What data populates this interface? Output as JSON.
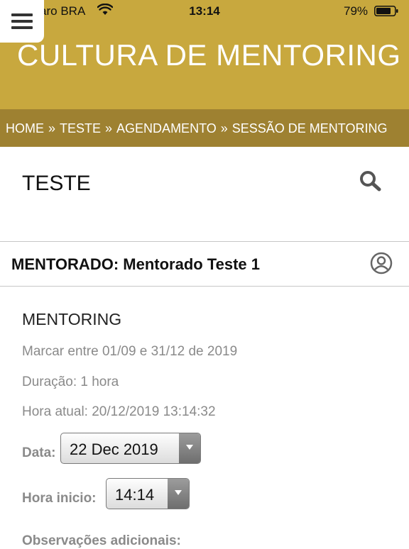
{
  "status_bar": {
    "carrier": "Claro BRA",
    "time": "13:14",
    "battery": "79%"
  },
  "header": {
    "title": "CULTURA DE MENTORING"
  },
  "breadcrumb": {
    "items": [
      "HOME",
      "TESTE",
      "AGENDAMENTO",
      "SESSÃO DE MENTORING"
    ],
    "separator": "»"
  },
  "page": {
    "title": "TESTE"
  },
  "mentorado": {
    "label": "MENTORADO: Mentorado Teste 1"
  },
  "session": {
    "title": "MENTORING",
    "schedule_window": "Marcar entre 01/09 e 31/12 de 2019",
    "duration": "Duração: 1 hora",
    "current_time": "Hora atual: 20/12/2019 13:14:32",
    "date_label": "Data:",
    "date_value": "22 Dec 2019",
    "start_label": "Hora inicio:",
    "start_value": "14:14",
    "notes_label": "Observações adicionais:"
  },
  "colors": {
    "header_bg": "#c8a83e",
    "breadcrumb_bg": "#9e8131",
    "text_muted": "#8a8a8a"
  },
  "icons": [
    "menu-icon",
    "wifi-icon",
    "battery-icon",
    "search-icon",
    "user-icon"
  ]
}
